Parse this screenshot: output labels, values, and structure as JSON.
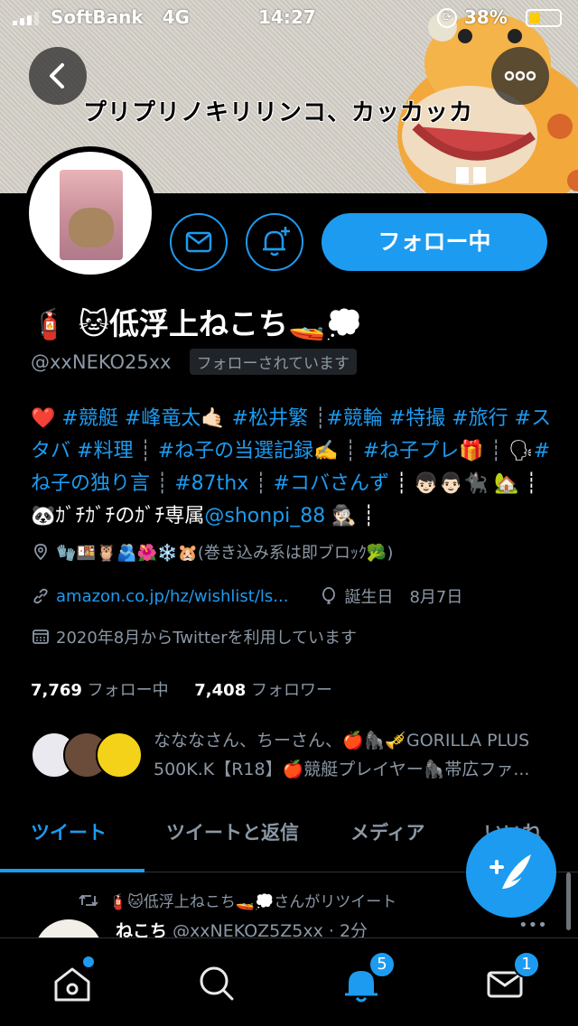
{
  "status_bar": {
    "carrier": "SoftBank",
    "network": "4G",
    "time": "14:27",
    "battery": "38%"
  },
  "banner": {
    "text": "プリプリノキリリンコ、カッカッカ"
  },
  "profile": {
    "name": "🧯 🐱低浮上ねこち🚤💭",
    "handle": "@xxNEKO25xx",
    "follows_you": "フォローされています",
    "follow_button": "フォロー中",
    "bio": [
      {
        "t": "❤️ ",
        "k": "text"
      },
      {
        "t": "#競艇",
        "k": "tag"
      },
      {
        "t": " ",
        "k": "text"
      },
      {
        "t": "#峰竜太",
        "k": "tag"
      },
      {
        "t": "🤙🏻 ",
        "k": "text"
      },
      {
        "t": "#松井繁",
        "k": "tag"
      },
      {
        "t": " ┊",
        "k": "sep"
      },
      {
        "t": "#競輪",
        "k": "tag"
      },
      {
        "t": " ",
        "k": "text"
      },
      {
        "t": "#特撮",
        "k": "tag"
      },
      {
        "t": " ",
        "k": "text"
      },
      {
        "t": "#旅行",
        "k": "tag"
      },
      {
        "t": " ",
        "k": "text"
      },
      {
        "t": "#スタバ",
        "k": "tag"
      },
      {
        "t": " ",
        "k": "text"
      },
      {
        "t": "#料理",
        "k": "tag"
      },
      {
        "t": " ┊ ",
        "k": "sep"
      },
      {
        "t": "#ね子の当選記録",
        "k": "tag"
      },
      {
        "t": "✍️ ┊ ",
        "k": "sep"
      },
      {
        "t": "#ね子プレ",
        "k": "tag"
      },
      {
        "t": "🎁 ┊ ",
        "k": "sep"
      },
      {
        "t": "🗣",
        "k": "text"
      },
      {
        "t": "#ね子の独り言",
        "k": "tag"
      },
      {
        "t": " ┊ ",
        "k": "sep"
      },
      {
        "t": "#87thx",
        "k": "tag"
      },
      {
        "t": " ┊ ",
        "k": "sep"
      },
      {
        "t": "#コバさんず",
        "k": "tag"
      },
      {
        "t": " ┊ 👦🏻👨🏻🐈‍⬛ ",
        "k": "text"
      },
      {
        "t": "🏡 ┊ 🐼ｶﾞﾁｶﾞﾁのｶﾞﾁ専属",
        "k": "text"
      },
      {
        "t": "@shonpi_88",
        "k": "tag"
      },
      {
        "t": " 🕵🏻 ┊",
        "k": "text"
      }
    ],
    "location": "🧤🍱🦉🫂🌺❄️🐹(巻き込み系は即ブロｯｸ🥦)",
    "website": "amazon.co.jp/hz/wishlist/ls...",
    "birthday": "誕生日　8月7日",
    "joined": "2020年8月からTwitterを利用しています",
    "following_count": "7,769",
    "following_label": "フォロー中",
    "followers_count": "7,408",
    "followers_label": "フォロワー",
    "followed_by_line1": "なななさん、ちーさん、🍎🦍🎺GORILLA PLUS",
    "followed_by_line2": "500K.K【R18】🍎競艇プレイヤー🦍帯広ファ..."
  },
  "tabs": [
    {
      "label": "ツイート",
      "active": true
    },
    {
      "label": "ツイートと返信",
      "active": false
    },
    {
      "label": "メディア",
      "active": false
    },
    {
      "label": "いいね",
      "active": false
    }
  ],
  "tweet": {
    "retweet_label": "🧯🐱低浮上ねこち🚤💭さんがリツイート",
    "author_name": "ねこち",
    "author_handle": "@xxNEKOZ5Z5xx",
    "time": "· 2分"
  },
  "bottom_nav": {
    "notifications_badge": "5",
    "messages_badge": "1"
  },
  "colors": {
    "accent": "#1d9bf0",
    "background": "#000000",
    "secondary_text": "#8b98a5"
  }
}
